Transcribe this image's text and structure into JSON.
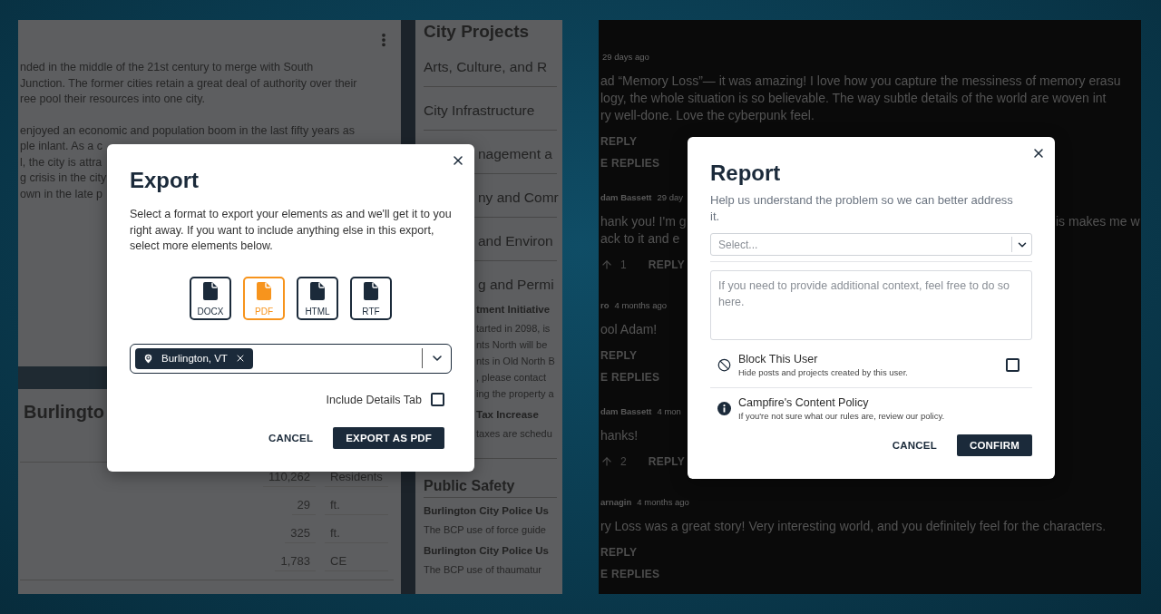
{
  "export_screen": {
    "article": {
      "paragraphs": [
        {
          "lines": [
            "nded in the middle of the 21st century to merge with South",
            "Junction. The former cities retain a great deal of authority over their",
            "ree pool their resources into one city."
          ]
        },
        {
          "lines": [
            "enjoyed an economic and population boom in the last fifty years as",
            "ple inlant. As a c",
            "l, the city is attra",
            "g crisis in the city",
            "own in the late p"
          ]
        }
      ],
      "subtitle": "Burlingto",
      "stats": [
        {
          "value": "110,262",
          "unit": "Residents"
        },
        {
          "value": "29",
          "unit": "ft."
        },
        {
          "value": "325",
          "unit": "ft."
        },
        {
          "value": "1,783",
          "unit": "CE"
        }
      ]
    },
    "projects": {
      "title": "City Projects",
      "items": [
        {
          "kind": "category",
          "text": "Arts, Culture, and R"
        },
        {
          "kind": "category",
          "text": "City Infrastructure"
        }
      ],
      "behind_dialog": [
        {
          "kind": "category",
          "text": "nagement a"
        },
        {
          "kind": "category",
          "text": "ny and Comr"
        },
        {
          "kind": "category",
          "text": "and Environ"
        },
        {
          "kind": "category-open",
          "text": "g and Permi"
        },
        {
          "kind": "project-title",
          "text": "tment Initiative"
        },
        {
          "kind": "project-text",
          "lines": [
            "tarted in 2098, is",
            "nts North will be",
            "nts in Old North B",
            ", please contact",
            "ing the property a"
          ]
        },
        {
          "kind": "project-title",
          "text": "Tax Increase"
        },
        {
          "kind": "project-text",
          "lines": [
            "taxes are schedu"
          ]
        }
      ],
      "after": [
        {
          "kind": "group-heading",
          "text": "Public Safety"
        },
        {
          "kind": "project-title",
          "text": "Burlington City Police Us"
        },
        {
          "kind": "project-text",
          "lines": [
            "The BCP use of force guide"
          ]
        },
        {
          "kind": "project-title",
          "text": "Burlington City Police Us"
        },
        {
          "kind": "project-text",
          "lines": [
            "The BCP use of thaumatur"
          ]
        }
      ]
    },
    "dialog": {
      "title": "Export",
      "description": "Select a format to export your elements as and we'll get it to you right away. If you want to include anything else in this export, select more elements below.",
      "formats": [
        {
          "label": "DOCX",
          "selected": false
        },
        {
          "label": "PDF",
          "selected": true
        },
        {
          "label": "HTML",
          "selected": false
        },
        {
          "label": "RTF",
          "selected": false
        }
      ],
      "tags": [
        {
          "label": "Burlington, VT"
        }
      ],
      "include_details": {
        "label": "Include Details Tab",
        "checked": false
      },
      "buttons": [
        {
          "label": "CANCEL",
          "kind": "text"
        },
        {
          "label": "EXPORT AS PDF",
          "kind": "primary"
        }
      ]
    }
  },
  "report_screen": {
    "comments": [
      {
        "time": "29 days ago",
        "lines": [
          "ad “Memory Loss”— it was amazing! I love how you capture the messiness of memory erasu",
          "logy, the whole situation is so believable. The way subtle details of the world are woven int",
          "ry well-done. Love the cyberpunk feel."
        ],
        "reply": "REPLY",
        "more": "E REPLIES"
      },
      {
        "author": "dam Bassett",
        "time": "29 day",
        "lines": [
          "hank you! I'm g",
          "ack to it and e"
        ],
        "right_fragment": "is makes me w",
        "vote": "1",
        "reply": "REPLY"
      },
      {
        "author": "ro",
        "time": "4 months ago",
        "lines": [
          "ool Adam!"
        ],
        "reply": "REPLY",
        "more": "E REPLIES"
      },
      {
        "author": "dam Bassett",
        "time": "4 mon",
        "lines": [
          "hanks!"
        ],
        "vote": "2",
        "reply": "REPLY"
      },
      {
        "author": "arnagin",
        "time": "4 months ago",
        "lines": [
          "ry Loss was a great story! Very interesting world, and you definitely feel for the characters."
        ],
        "reply": "REPLY",
        "more": "E REPLIES"
      }
    ],
    "dialog": {
      "title": "Report",
      "description": "Help us understand the problem so we can better address it.",
      "select": {
        "placeholder": "Select..."
      },
      "context": {
        "placeholder": "If you need to provide additional context, feel free to do so here."
      },
      "options": [
        {
          "kind": "block",
          "title": "Block This User",
          "subtitle": "Hide posts and projects created by this user.",
          "checked": false
        },
        {
          "kind": "info",
          "title": "Campfire's Content Policy",
          "subtitle": "If you're not sure what our rules are, review our policy."
        }
      ],
      "buttons": [
        {
          "label": "CANCEL",
          "kind": "text"
        },
        {
          "label": "CONFIRM",
          "kind": "primary"
        }
      ]
    }
  }
}
